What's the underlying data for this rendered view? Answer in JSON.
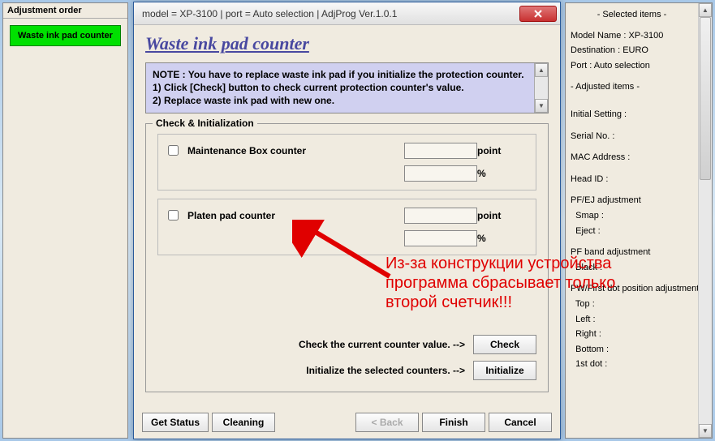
{
  "left_panel": {
    "title": "Adjustment order",
    "button": "Waste ink pad counter"
  },
  "right_panel": {
    "selected_title": "- Selected items -",
    "model": "Model Name : XP-3100",
    "destination": "Destination : EURO",
    "port": "Port : Auto selection",
    "adjusted_title": "- Adjusted items -",
    "items": [
      "Initial Setting :",
      "Serial No. :",
      "MAC Address :",
      "Head ID :",
      "PF/EJ adjustment",
      "  Smap :",
      "  Eject :",
      "PF band adjustment",
      "  Black :",
      "PW/First dot position adjustment",
      "  Top :",
      "  Left :",
      "  Right :",
      "  Bottom :",
      "  1st dot :"
    ]
  },
  "dialog": {
    "title": "model = XP-3100 | port = Auto selection | AdjProg Ver.1.0.1",
    "main_title": "Waste ink pad counter",
    "note_line1": "NOTE : You have to replace waste ink pad if you initialize the protection counter.",
    "note_line2": "1) Click [Check] button to check current protection counter's value.",
    "note_line3": "2) Replace waste ink pad with new one.",
    "group_title": "Check & Initialization",
    "counter1_label": "Maintenance Box counter",
    "counter2_label": "Platen pad counter",
    "unit_point": "point",
    "unit_percent": "%",
    "check_label": "Check the current counter value. -->",
    "init_label": "Initialize the selected counters. -->",
    "btn_check": "Check",
    "btn_initialize": "Initialize",
    "btn_getstatus": "Get Status",
    "btn_cleaning": "Cleaning",
    "btn_back": "< Back",
    "btn_finish": "Finish",
    "btn_cancel": "Cancel"
  },
  "annotation": {
    "line1": "Из-за конструкции устройства",
    "line2": "программа сбрасывает только",
    "line3": "второй счетчик!!!"
  }
}
